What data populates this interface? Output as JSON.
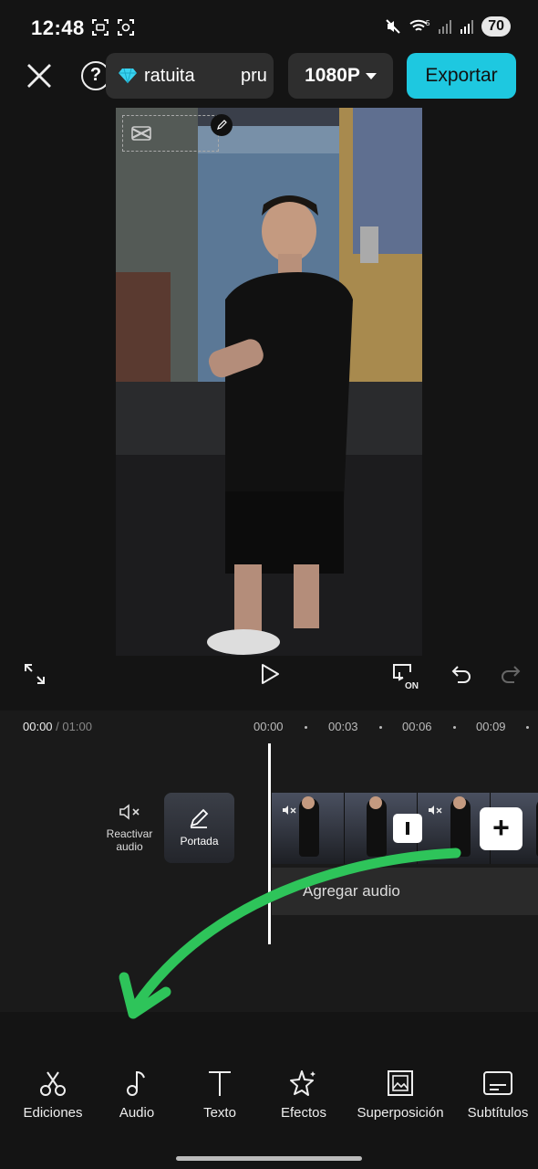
{
  "status": {
    "time": "12:48",
    "battery": "70",
    "signal_label": "5"
  },
  "topbar": {
    "help_label": "?",
    "pro_text": "ratuita",
    "pro_suffix": "pru",
    "resolution": "1080P",
    "export_label": "Exportar"
  },
  "timeline": {
    "current_time": "00:00",
    "total_time": "/ 01:00",
    "ruler": [
      "00:00",
      "00:03",
      "00:06",
      "00:09"
    ],
    "mute_label": "Reactivar audio",
    "cover_label": "Portada",
    "add_audio_label": "Agregar audio",
    "add_clip_label": "+"
  },
  "tools": [
    {
      "label": "Ediciones",
      "icon": "scissors-icon"
    },
    {
      "label": "Audio",
      "icon": "music-note-icon"
    },
    {
      "label": "Texto",
      "icon": "text-icon"
    },
    {
      "label": "Efectos",
      "icon": "sparkle-star-icon"
    },
    {
      "label": "Superposición",
      "icon": "overlay-image-icon"
    },
    {
      "label": "Subtítulos",
      "icon": "subtitles-icon"
    }
  ],
  "colors": {
    "accent": "#1ec8e0",
    "annotation_arrow": "#2ec45a",
    "background": "#141414"
  }
}
